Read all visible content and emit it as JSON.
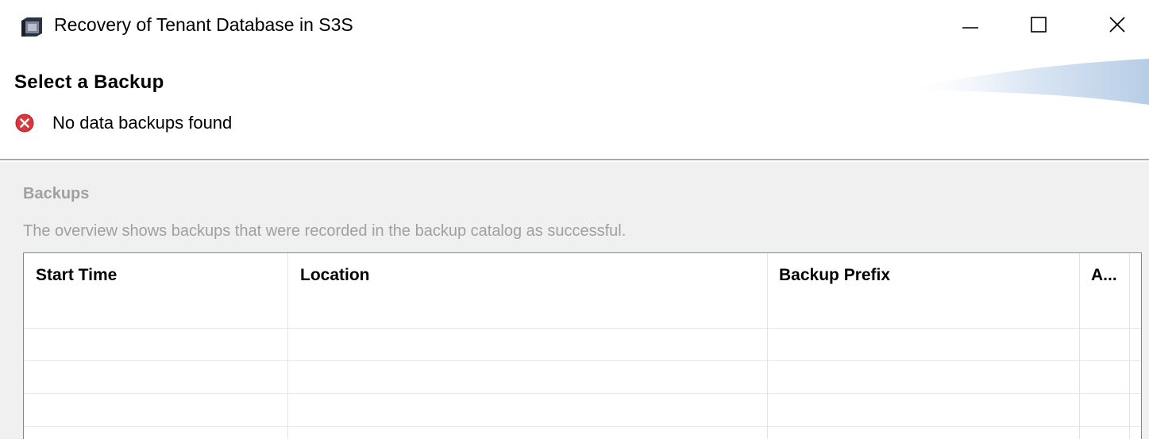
{
  "window": {
    "title": "Recovery of Tenant Database in S3S",
    "controls": {
      "minimize_icon": "minimize-icon",
      "maximize_icon": "maximize-icon",
      "close_icon": "close-icon"
    }
  },
  "header": {
    "title": "Select a Backup",
    "message": {
      "type": "error",
      "icon": "error-icon",
      "text": "No data backups found"
    }
  },
  "backups": {
    "title": "Backups",
    "description": "The overview shows backups that were recorded in the backup catalog as successful.",
    "table": {
      "columns": [
        "Start Time",
        "Location",
        "Backup Prefix",
        "A..."
      ],
      "rows": []
    }
  },
  "colors": {
    "error": "#d9363e",
    "disabled_text": "#a0a0a0",
    "panel_background": "#f0f0f0",
    "grid_line": "#e6e6e6"
  }
}
